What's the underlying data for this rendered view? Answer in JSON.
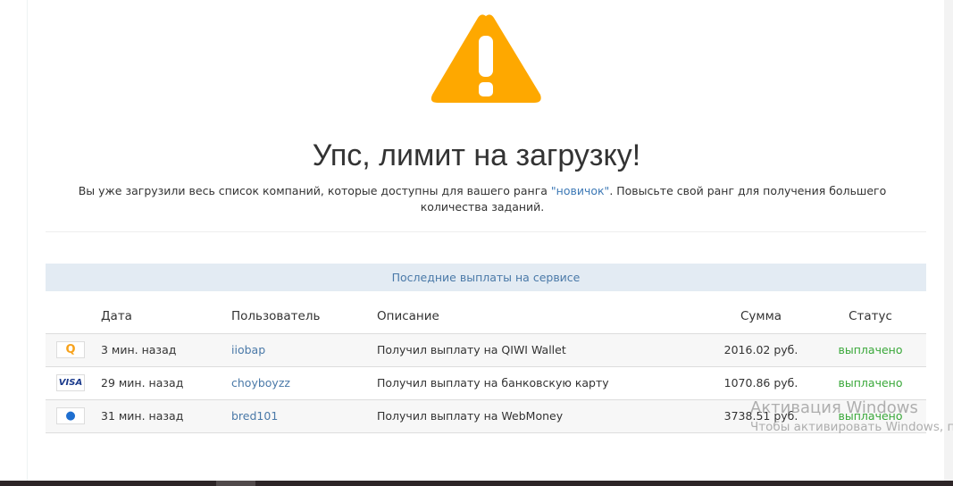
{
  "title": "Упс, лимит на загрузку!",
  "message": {
    "before": "Вы уже загрузили весь список компаний, которые доступны для вашего ранга ",
    "rank": "\"новичок\"",
    "after": ". Повысьте свой ранг для получения большего количества заданий."
  },
  "panel_title": "Последние выплаты на сервисе",
  "columns": {
    "date": "Дата",
    "user": "Пользователь",
    "desc": "Описание",
    "sum": "Сумма",
    "status": "Статус"
  },
  "rows": [
    {
      "icon": "qiwi-icon",
      "icon_text": "Q",
      "date": "3 мин. назад",
      "user": "iiobap",
      "desc": "Получил выплату на QIWI Wallet",
      "sum": "2016.02 руб.",
      "status": "выплачено"
    },
    {
      "icon": "visa-icon",
      "icon_text": "VISA",
      "date": "29 мин. назад",
      "user": "choyboyzz",
      "desc": "Получил выплату на банковскую карту",
      "sum": "1070.86 руб.",
      "status": "выплачено"
    },
    {
      "icon": "webmoney-icon",
      "icon_text": "●",
      "date": "31 мин. назад",
      "user": "bred101",
      "desc": "Получил выплату на WebMoney",
      "sum": "3738.51 руб.",
      "status": "выплачено"
    }
  ],
  "watermark": {
    "line1": "Активация Windows",
    "line2": "Чтобы активировать Windows, пе"
  }
}
